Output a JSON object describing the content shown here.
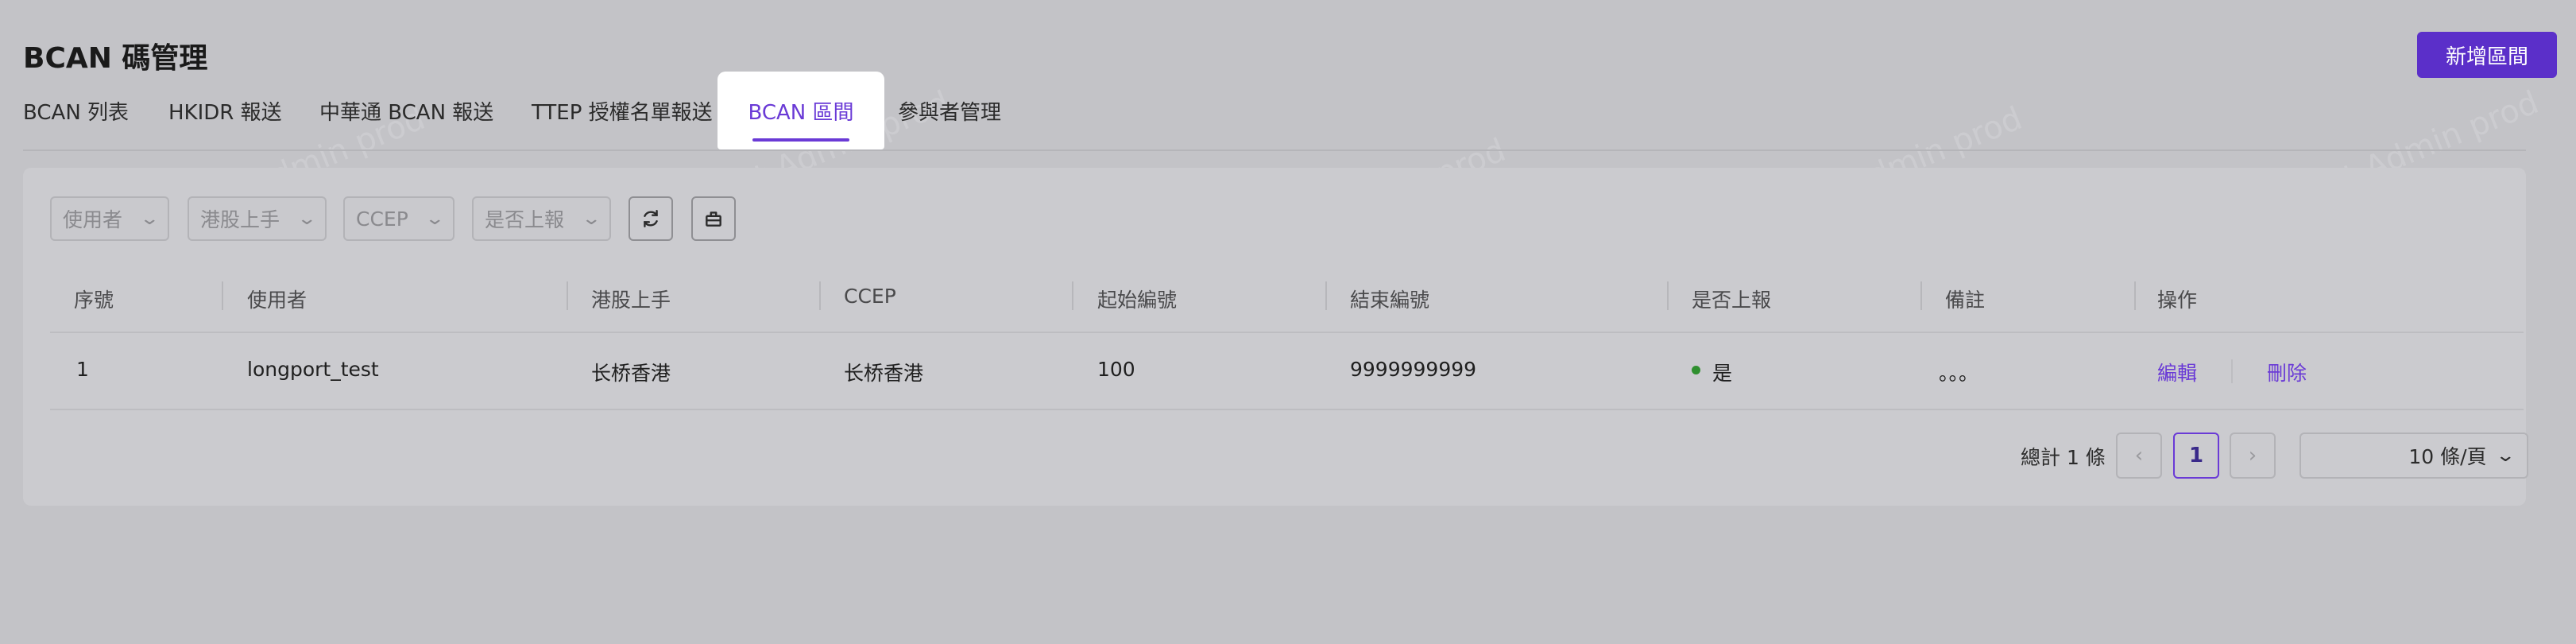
{
  "page": {
    "title": "BCAN 碼管理",
    "add_button": "新增區間"
  },
  "tabs": [
    {
      "label": "BCAN 列表"
    },
    {
      "label": "HKIDR 報送"
    },
    {
      "label": "中華通 BCAN 報送"
    },
    {
      "label": "TTEP 授權名單報送"
    },
    {
      "label": "BCAN 區間"
    },
    {
      "label": "參與者管理"
    }
  ],
  "filters": {
    "user": "使用者",
    "hk_broker": "港股上手",
    "ccep": "CCEP",
    "reported": "是否上報"
  },
  "table": {
    "headers": [
      "序號",
      "使用者",
      "港股上手",
      "CCEP",
      "起始編號",
      "結束編號",
      "是否上報",
      "備註",
      "操作"
    ],
    "rows": [
      {
        "index": "1",
        "user": "longport_test",
        "hk_broker": "长桥香港",
        "ccep": "长桥香港",
        "start": "100",
        "end": "9999999999",
        "reported": "是",
        "remark": "。。。",
        "edit": "編輯",
        "delete": "刪除"
      }
    ]
  },
  "pagination": {
    "total": "總計 1 條",
    "current_page": "1",
    "page_size": "10 條/頁"
  },
  "watermark": {
    "text": "LongPort Test Admin prod"
  },
  "colors": {
    "accent": "#6a3ad6",
    "primary_button": "#5b2fc9",
    "status_ok": "#2f8f2f"
  }
}
